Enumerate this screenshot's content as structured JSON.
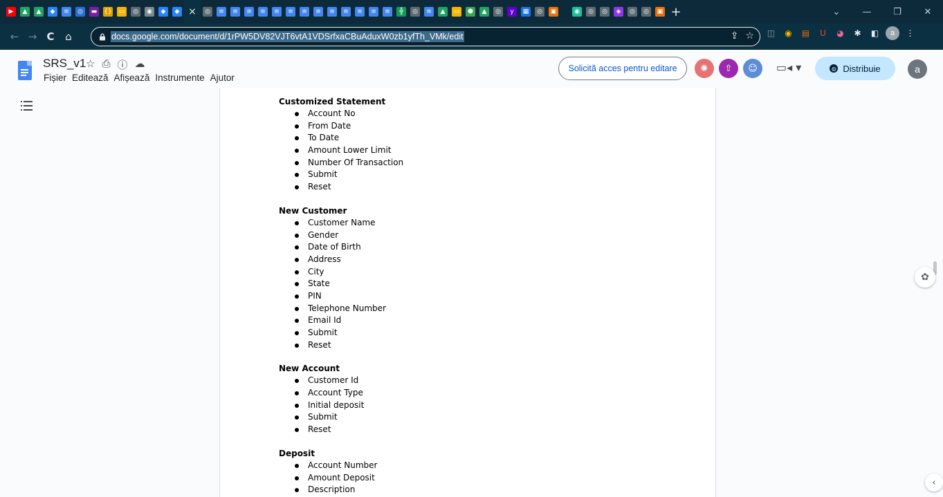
{
  "colors": {
    "tab_strip": "#0c2a3a",
    "toolbar": "#0b3042",
    "docs_blue": "#4285f4",
    "share_button_bg": "#c2e7ff",
    "link_blue": "#0b57d0"
  },
  "browser": {
    "tabs": [
      {
        "icon": "youtube-icon",
        "color": "#ff0000",
        "glyph": "▶"
      },
      {
        "icon": "drive-icon",
        "color": "#1fa463",
        "glyph": "▲"
      },
      {
        "icon": "drive-icon",
        "color": "#1fa463",
        "glyph": "▲"
      },
      {
        "icon": "jira-icon",
        "color": "#2684ff",
        "glyph": "◆"
      },
      {
        "icon": "docs-icon",
        "color": "#4285f4",
        "glyph": "≡"
      },
      {
        "icon": "globe-icon",
        "color": "#2b6fd6",
        "glyph": "◎"
      },
      {
        "icon": "mail-icon",
        "color": "#7b1fa2",
        "glyph": "▬"
      },
      {
        "icon": "code-icon",
        "color": "#e6a100",
        "glyph": "{}"
      },
      {
        "icon": "slides-icon",
        "color": "#f4b400",
        "glyph": "▭"
      },
      {
        "icon": "globe-icon",
        "color": "#5f6b73",
        "glyph": "◎"
      },
      {
        "icon": "openai-icon",
        "color": "#7a8a90",
        "glyph": "◉"
      },
      {
        "icon": "jira-icon",
        "color": "#2684ff",
        "glyph": "◆"
      },
      {
        "icon": "jira-icon",
        "color": "#2684ff",
        "glyph": "◆"
      },
      {
        "icon": "close-icon",
        "color": "transparent",
        "glyph": "×",
        "active": true
      },
      {
        "icon": "globe-icon",
        "color": "#5f6b73",
        "glyph": "◎"
      },
      {
        "icon": "docs-icon",
        "color": "#4285f4",
        "glyph": "≡"
      },
      {
        "icon": "docs-icon",
        "color": "#4285f4",
        "glyph": "≡"
      },
      {
        "icon": "docs-icon",
        "color": "#4285f4",
        "glyph": "≡"
      },
      {
        "icon": "docs-icon",
        "color": "#4285f4",
        "glyph": "≡"
      },
      {
        "icon": "docs-icon",
        "color": "#4285f4",
        "glyph": "≡"
      },
      {
        "icon": "docs-icon",
        "color": "#4285f4",
        "glyph": "≡"
      },
      {
        "icon": "docs-icon",
        "color": "#4285f4",
        "glyph": "≡"
      },
      {
        "icon": "docs-icon",
        "color": "#4285f4",
        "glyph": "≡"
      },
      {
        "icon": "docs-icon",
        "color": "#4285f4",
        "glyph": "≡"
      },
      {
        "icon": "docs-icon",
        "color": "#4285f4",
        "glyph": "≡"
      },
      {
        "icon": "docs-icon",
        "color": "#4285f4",
        "glyph": "≡"
      },
      {
        "icon": "docs-icon",
        "color": "#4285f4",
        "glyph": "≡"
      },
      {
        "icon": "docs-icon",
        "color": "#4285f4",
        "glyph": "≡"
      },
      {
        "icon": "sheets-icon",
        "color": "#0f9d58",
        "glyph": "╬"
      },
      {
        "icon": "globe-icon",
        "color": "#5f6b73",
        "glyph": "◎"
      },
      {
        "icon": "docs-icon",
        "color": "#4285f4",
        "glyph": "≡"
      },
      {
        "icon": "drive-icon",
        "color": "#1fa463",
        "glyph": "▲"
      },
      {
        "icon": "slides-icon",
        "color": "#f4b400",
        "glyph": "▭"
      },
      {
        "icon": "package-icon",
        "color": "#34a853",
        "glyph": "⬢"
      },
      {
        "icon": "drive-icon",
        "color": "#1fa463",
        "glyph": "▲"
      },
      {
        "icon": "globe-icon",
        "color": "#5f6b73",
        "glyph": "◎"
      },
      {
        "icon": "yahoo-icon",
        "color": "#6001d2",
        "glyph": "y"
      },
      {
        "icon": "calendar-icon",
        "color": "#1a73e8",
        "glyph": "▦"
      },
      {
        "icon": "globe-icon",
        "color": "#5f6b73",
        "glyph": "◎"
      },
      {
        "icon": "puzzle-site-icon",
        "color": "#e8710a",
        "glyph": "▣"
      },
      {
        "gap": true
      },
      {
        "icon": "grammarly-icon",
        "color": "#15c39a",
        "glyph": "◉"
      },
      {
        "icon": "globe-icon",
        "color": "#5f6b73",
        "glyph": "◎"
      },
      {
        "icon": "globe-icon",
        "color": "#5f6b73",
        "glyph": "◎"
      },
      {
        "icon": "shield-icon",
        "color": "#9334e6",
        "glyph": "◈"
      },
      {
        "icon": "globe-icon",
        "color": "#5f6b73",
        "glyph": "◎"
      },
      {
        "icon": "globe-icon",
        "color": "#5f6b73",
        "glyph": "◎"
      },
      {
        "icon": "puzzle-site-icon",
        "color": "#e8710a",
        "glyph": "▣"
      }
    ],
    "new_tab_glyph": "+",
    "window_controls": {
      "tab_search": "⌄",
      "minimize": "—",
      "restore": "❐",
      "close": "✕"
    },
    "nav": {
      "back": "←",
      "forward": "→",
      "reload": "C",
      "home": "⌂"
    },
    "url": "docs.google.com/document/d/1rPW5DV82VJT6vtA1VDSrfxaCBuAduxW0zb1yfTh_VMk/edit",
    "omnibox_icons": {
      "share": "⇪",
      "bookmark": "☆"
    },
    "extensions": [
      {
        "icon": "reader-icon",
        "glyph": "◫",
        "color": "#9aa0a6"
      },
      {
        "icon": "color-picker-icon",
        "glyph": "◉",
        "color": "#f4b400"
      },
      {
        "icon": "chart-extension-icon",
        "glyph": "▤",
        "color": "#e8710a"
      },
      {
        "icon": "magnet-icon",
        "glyph": "Ս",
        "color": "#ea4335"
      },
      {
        "icon": "eyes-icon",
        "glyph": "◕",
        "color": "#f06292"
      },
      {
        "icon": "puzzle-icon",
        "glyph": "✱",
        "color": "#e8eaed"
      },
      {
        "icon": "side-panel-icon",
        "glyph": "◧",
        "color": "#e8eaed"
      }
    ],
    "profile_initial": "a",
    "menu_glyph": "⋮"
  },
  "doc": {
    "title": "SRS_v1",
    "title_icons": {
      "star": "☆",
      "move": "⎙",
      "info": "ⓘ",
      "cloud": "☁"
    },
    "menu": [
      "Fișier",
      "Editează",
      "Afișează",
      "Instrumente",
      "Ajutor"
    ],
    "request_edit_label": "Solicită acces pentru editare",
    "collaborators": [
      {
        "name": "collaborator-avatar-octopus",
        "color": "#e57373",
        "glyph": "✺"
      },
      {
        "name": "collaborator-avatar-penguin",
        "color": "#9c27b0",
        "glyph": "⇧"
      },
      {
        "name": "collaborator-avatar-cat",
        "color": "#5c8dd6",
        "glyph": "☺"
      }
    ],
    "meet_glyph": "▭◂ ▾",
    "share_label": "Distribuie",
    "user_initial": "a",
    "sections": [
      {
        "title": "Customized Statement",
        "items": [
          "Account No",
          "From Date",
          "To Date",
          "Amount Lower Limit",
          "Number Of Transaction",
          "Submit",
          "Reset"
        ]
      },
      {
        "title": "New Customer",
        "items": [
          "Customer Name",
          "Gender",
          "Date of Birth",
          "Address",
          "City",
          "State",
          "PIN",
          "Telephone Number",
          "Email Id",
          "Submit",
          "Reset"
        ]
      },
      {
        "title": "New Account",
        "items": [
          "Customer Id",
          "Account Type",
          "Initial deposit",
          "Submit",
          "Reset"
        ]
      },
      {
        "title": "Deposit",
        "items": [
          "Account Number",
          "Amount Deposit",
          "Description"
        ]
      }
    ],
    "gemini_glyph": "✿",
    "side_toggle_glyph": "‹"
  }
}
